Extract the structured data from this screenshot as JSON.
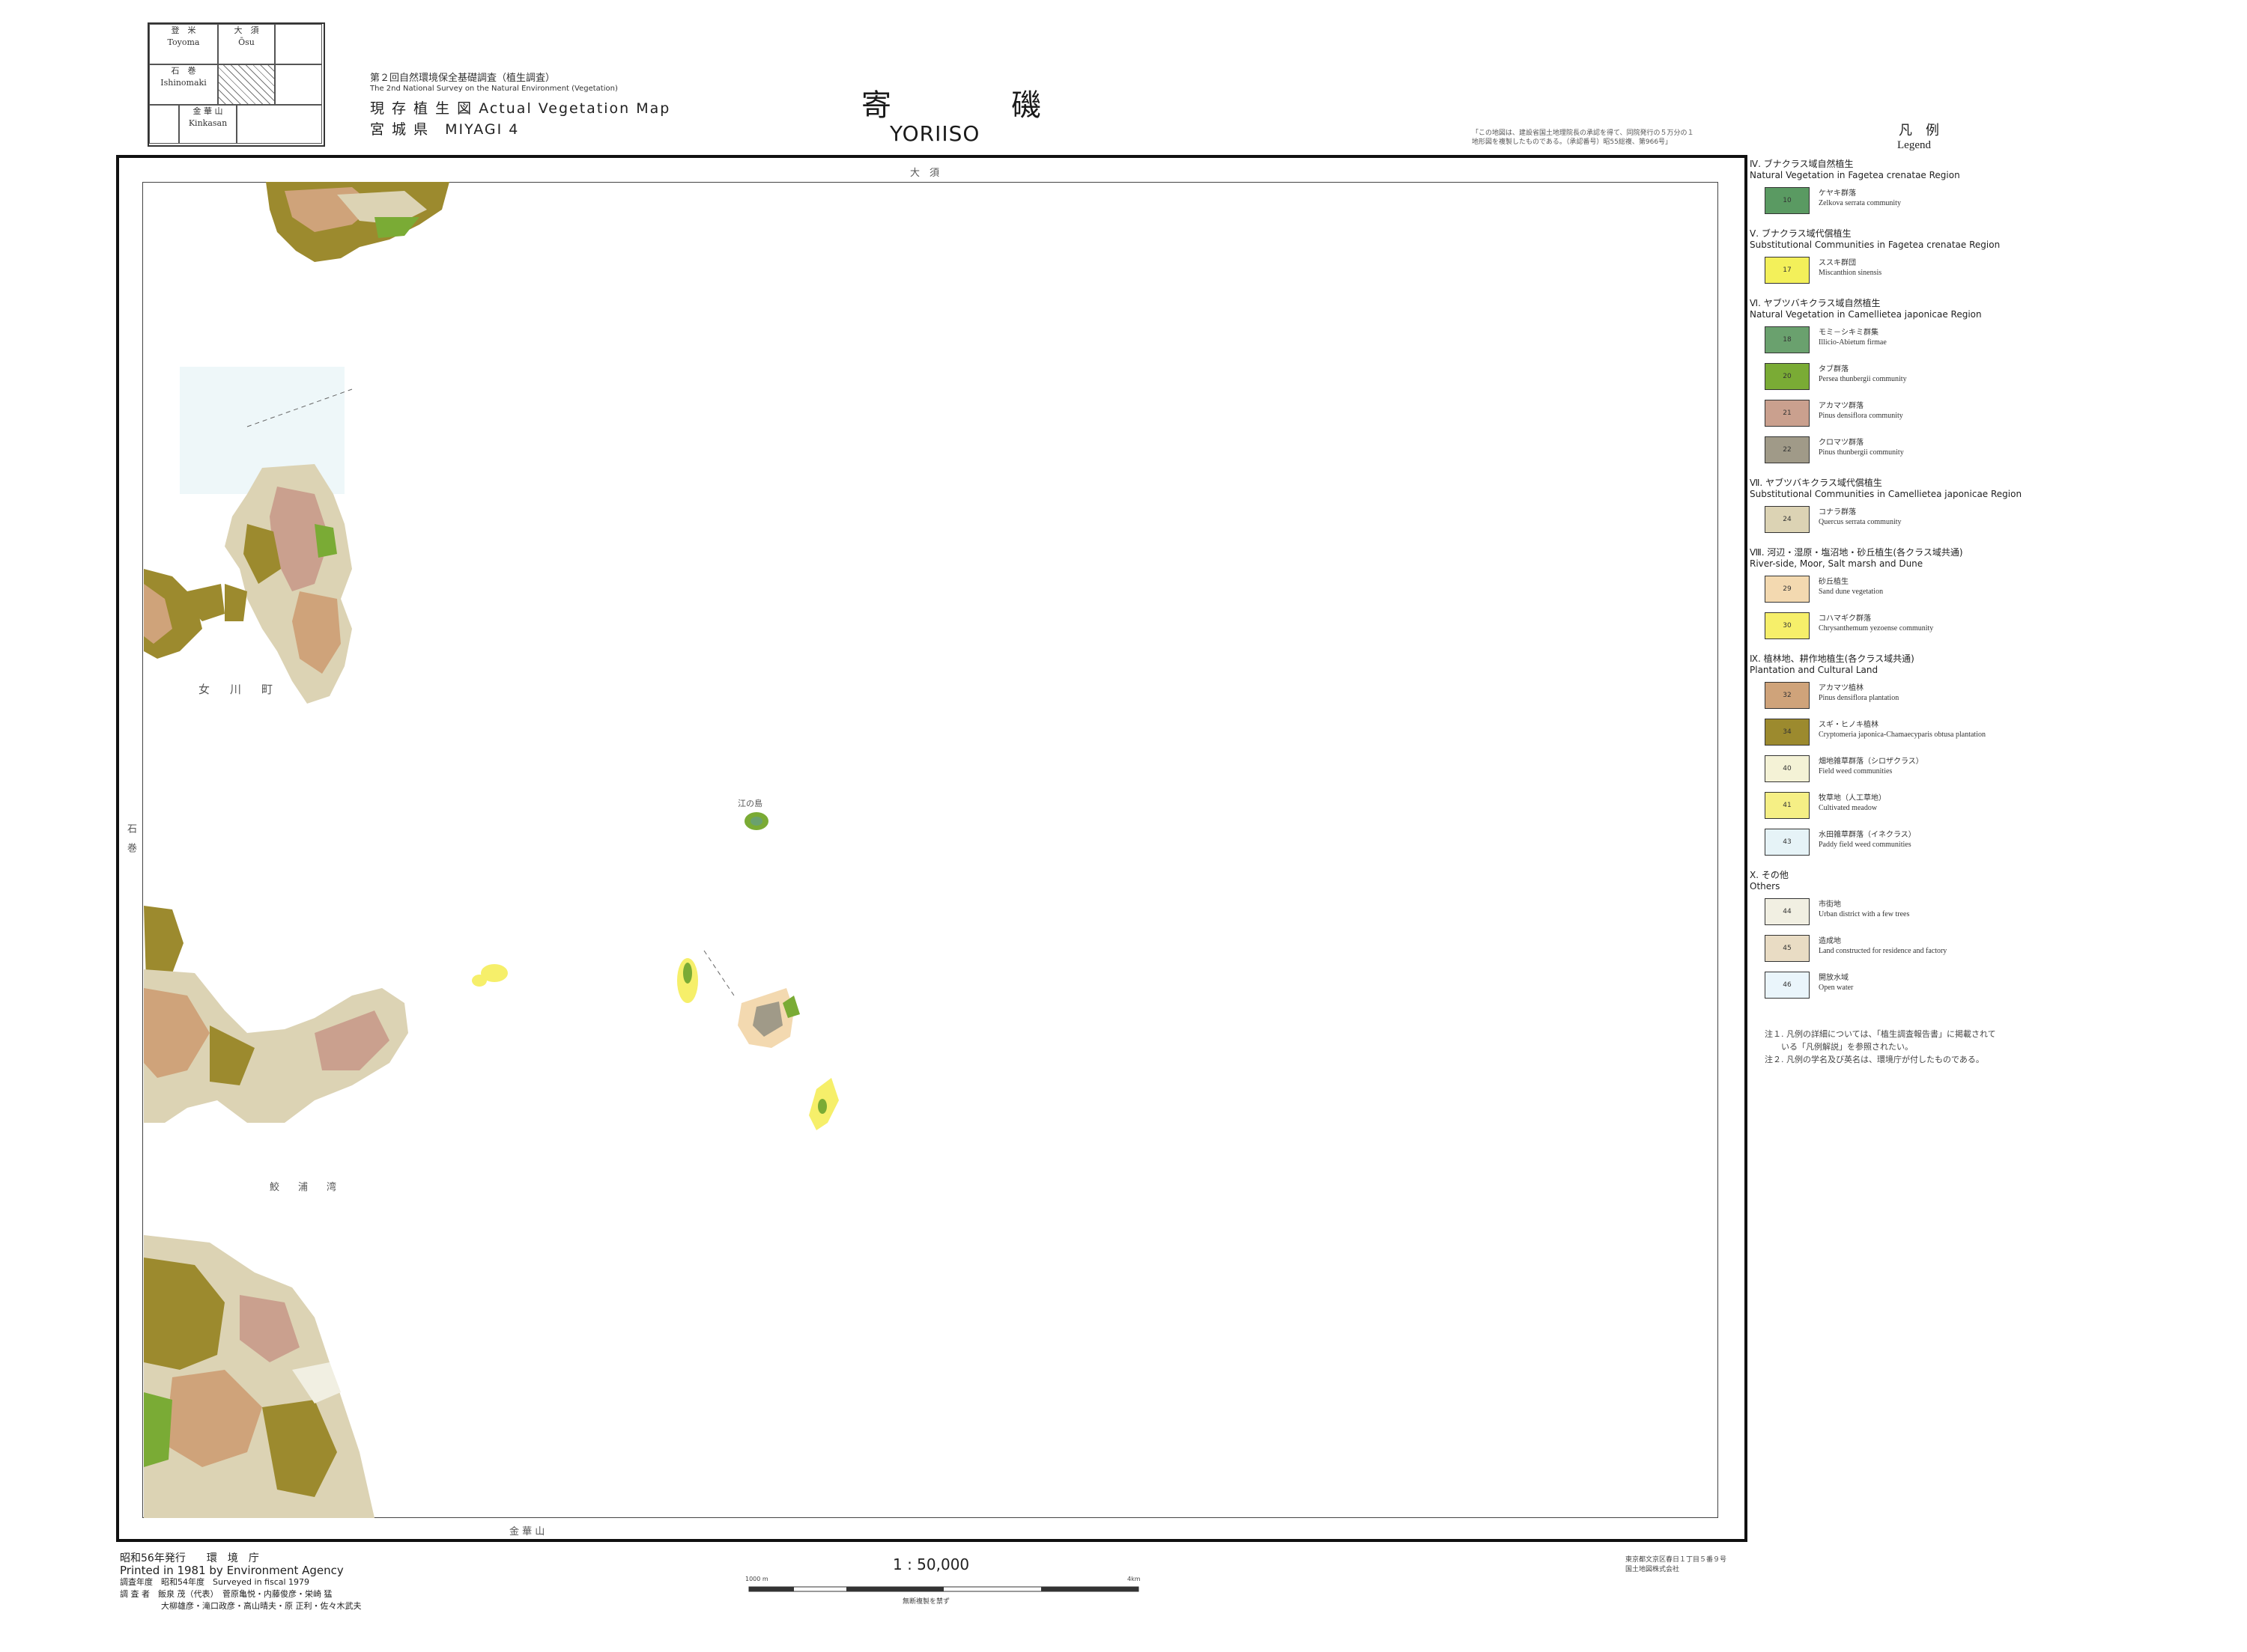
{
  "index_map": {
    "cells": [
      {
        "jp": "登　米",
        "en": "Toyoma"
      },
      {
        "jp": "大　須",
        "en": "Ōsu"
      },
      {
        "jp": "石　巻",
        "en": "Ishinomaki"
      },
      {
        "jp": "",
        "en": ""
      },
      {
        "jp": "金 華 山",
        "en": "Kinkasan"
      }
    ]
  },
  "header": {
    "survey_jp": "第２回自然環境保全基礎調査（植生調査）",
    "survey_en": "The 2nd National Survey on the Natural Environment (Vegetation)",
    "map_type": "現 存 植 生 図 Actual Vegetation Map",
    "prefecture": "宮 城 県　MIYAGI 4",
    "title_jp": "寄　磯",
    "title_en": "YORIISO",
    "copyright_note_1": "「この地図は、建設省国土地理院長の承認を得て、同院発行の５万分の１",
    "copyright_note_2": "地形図を複製したものである。（承認番号）昭55総複、第966号」"
  },
  "map": {
    "top_label": "大　須",
    "bottom_label": "金 華 山",
    "left_label": "石　巻",
    "places": [
      "女　川　町",
      "鮫　浦　湾",
      "江の島"
    ]
  },
  "legend": {
    "title_jp": "凡　例",
    "title_en": "Legend",
    "sections": [
      {
        "jp": "Ⅳ. ブナクラス域自然植生",
        "en": "Natural Vegetation in Fagetea crenatae Region",
        "items": [
          {
            "code": "10",
            "jp": "ケヤキ群落",
            "en": "Zelkova serrata community",
            "color": "#5a9a62"
          }
        ]
      },
      {
        "jp": "Ⅴ. ブナクラス域代償植生",
        "en": "Substitutional Communities in Fagetea crenatae Region",
        "items": [
          {
            "code": "17",
            "jp": "ススキ群団",
            "en": "Miscanthion sinensis",
            "color": "#f3f05a"
          }
        ]
      },
      {
        "jp": "Ⅵ. ヤブツバキクラス域自然植生",
        "en": "Natural Vegetation in Camellietea japonicae Region",
        "items": [
          {
            "code": "18",
            "jp": "モミ－シキミ群集",
            "en": "Illicio-Abietum firmae",
            "color": "#6aa16e"
          },
          {
            "code": "20",
            "jp": "タブ群落",
            "en": "Persea thunbergii community",
            "color": "#7aab35"
          },
          {
            "code": "21",
            "jp": "アカマツ群落",
            "en": "Pinus densiflora community",
            "color": "#caa08e"
          },
          {
            "code": "22",
            "jp": "クロマツ群落",
            "en": "Pinus thunbergii community",
            "color": "#a09a88"
          }
        ]
      },
      {
        "jp": "Ⅶ. ヤブツバキクラス域代償植生",
        "en": "Substitutional Communities in Camellietea japonicae Region",
        "items": [
          {
            "code": "24",
            "jp": "コナラ群落",
            "en": "Quercus serrata community",
            "color": "#dcd3b4"
          }
        ]
      },
      {
        "jp": "Ⅷ. 河辺・湿原・塩沼地・砂丘植生(各クラス域共通)",
        "en": "River-side, Moor, Salt marsh and Dune",
        "items": [
          {
            "code": "29",
            "jp": "砂丘植生",
            "en": "Sand dune vegetation",
            "color": "#f3d9b0"
          },
          {
            "code": "30",
            "jp": "コハマギク群落",
            "en": "Chrysanthemum yezoense community",
            "color": "#f6ef6a"
          }
        ]
      },
      {
        "jp": "Ⅸ. 植林地、耕作地植生(各クラス域共通)",
        "en": "Plantation and Cultural Land",
        "items": [
          {
            "code": "32",
            "jp": "アカマツ植林",
            "en": "Pinus densiflora plantation",
            "color": "#cfa37a"
          },
          {
            "code": "34",
            "jp": "スギ・ヒノキ植林",
            "en": "Cryptomeria japonica-Chamaecyparis obtusa plantation",
            "color": "#9c8a2e"
          },
          {
            "code": "40",
            "jp": "畑地雑草群落（シロザクラス）",
            "en": "Field weed communities",
            "color": "#f4f2d6"
          },
          {
            "code": "41",
            "jp": "牧草地（人工草地）",
            "en": "Cultivated meadow",
            "color": "#f5ef85"
          },
          {
            "code": "43",
            "jp": "水田雑草群落（イネクラス）",
            "en": "Paddy field weed communities",
            "color": "#e6f3f7"
          }
        ]
      },
      {
        "jp": "Ⅹ. その他",
        "en": "Others",
        "items": [
          {
            "code": "44",
            "jp": "市街地",
            "en": "Urban district with a few trees",
            "color": "#f1efe2"
          },
          {
            "code": "45",
            "jp": "造成地",
            "en": "Land constructed for residence and factory",
            "color": "#e9dcc4"
          },
          {
            "code": "46",
            "jp": "開放水域",
            "en": "Open water",
            "color": "#eaf5fb"
          }
        ]
      }
    ],
    "note_1": "注１. 凡例の詳細については、「植生調査報告書」に掲載されて",
    "note_1b": "　　いる「凡例解説」を参照されたい。",
    "note_2": "注２. 凡例の学名及び英名は、環境庁が付したものである。"
  },
  "footer": {
    "issued_jp": "昭和56年発行　　環　境　庁",
    "issued_en": "Printed in 1981 by Environment Agency",
    "surveyed": "調査年度　昭和54年度　Surveyed in fiscal 1979",
    "surveyors_1": "調 査 者　飯泉 茂（代表）　菅原亀悦・内藤俊彦・栄崎 猛",
    "surveyors_2": "　　　　　大柳雄彦・滝口政彦・高山晴夫・原 正利・佐々木武夫",
    "scale": "1 : 50,000",
    "scale_start": "1000 m",
    "scale_end": "4km",
    "scale_note": "無断複製を禁ず",
    "printer_1": "東京都文京区春日１丁目５番９号",
    "printer_2": "国土地図株式会社"
  },
  "colors": {
    "sea": "#ffffff",
    "frame": "#111111"
  }
}
